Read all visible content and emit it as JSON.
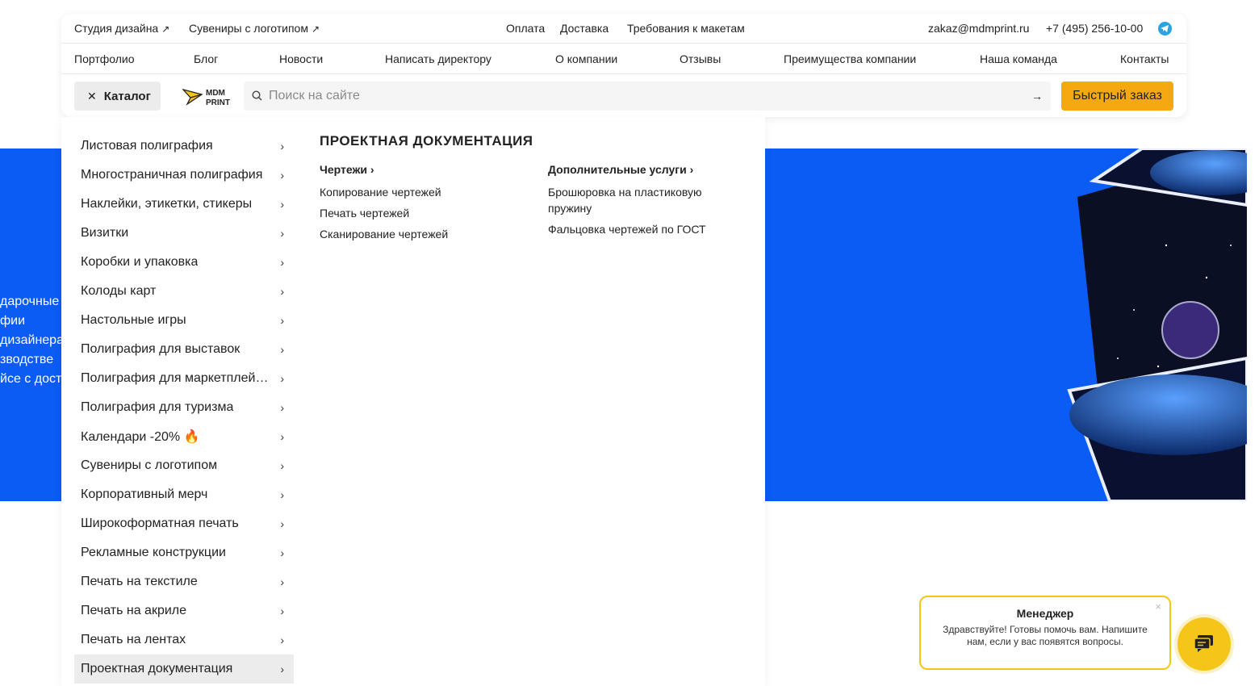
{
  "topbar": {
    "left_links": [
      "Студия дизайна",
      "Сувениры с логотипом"
    ],
    "center_links": [
      "Оплата",
      "Доставка",
      "Требования к макетам"
    ],
    "email": "zakaz@mdmprint.ru",
    "phone": "+7 (495) 256-10-00",
    "external_icon": "↗"
  },
  "nav": {
    "items": [
      "Портфолио",
      "Блог",
      "Новости",
      "Написать директору",
      "О компании",
      "Отзывы",
      "Преимущества компании",
      "Наша команда",
      "Контакты"
    ]
  },
  "search": {
    "catalog_label": "Каталог",
    "close_glyph": "✕",
    "placeholder": "Поиск на сайте",
    "go_glyph": "→",
    "quick_order_label": "Быстрый заказ",
    "logo_text_top": "MDM",
    "logo_text_bottom": "PRINT"
  },
  "catalog": {
    "items": [
      "Листовая полиграфия",
      "Многостраничная полиграфия",
      "Наклейки, этикетки, стикеры",
      "Визитки",
      "Коробки и упаковка",
      "Колоды карт",
      "Настольные игры",
      "Полиграфия для выставок",
      "Полиграфия для маркетплейсов",
      "Полиграфия для туризма",
      "Календари -20% 🔥",
      "Сувениры с логотипом",
      "Корпоративный мерч",
      "Широкоформатная печать",
      "Рекламные конструкции",
      "Печать на текстиле",
      "Печать на акриле",
      "Печать на лентах",
      "Проектная документация"
    ],
    "active_index": 18,
    "chevron": "›"
  },
  "submenu": {
    "title": "ПРОЕКТНАЯ ДОКУМЕНТАЦИЯ",
    "columns": [
      {
        "head": "Чертежи",
        "links": [
          "Копирование чертежей",
          "Печать чертежей",
          "Сканирование чертежей"
        ]
      },
      {
        "head": "Дополнительные услуги",
        "links": [
          "Брошюровка на пластиковую пружину",
          "Фальцовка чертежей по ГОСТ"
        ]
      }
    ]
  },
  "hero": {
    "lines": [
      "дарочные",
      "фии",
      "дизайнера",
      "зводстве",
      "йсе с доста"
    ],
    "accent_color": "#0a5cf5"
  },
  "chat": {
    "title": "Менеджер",
    "message": "Здравствуйте! Готовы помочь вам. Напишите нам, если у вас появятся вопросы.",
    "close_glyph": "×",
    "accent_color": "#f5c518"
  }
}
